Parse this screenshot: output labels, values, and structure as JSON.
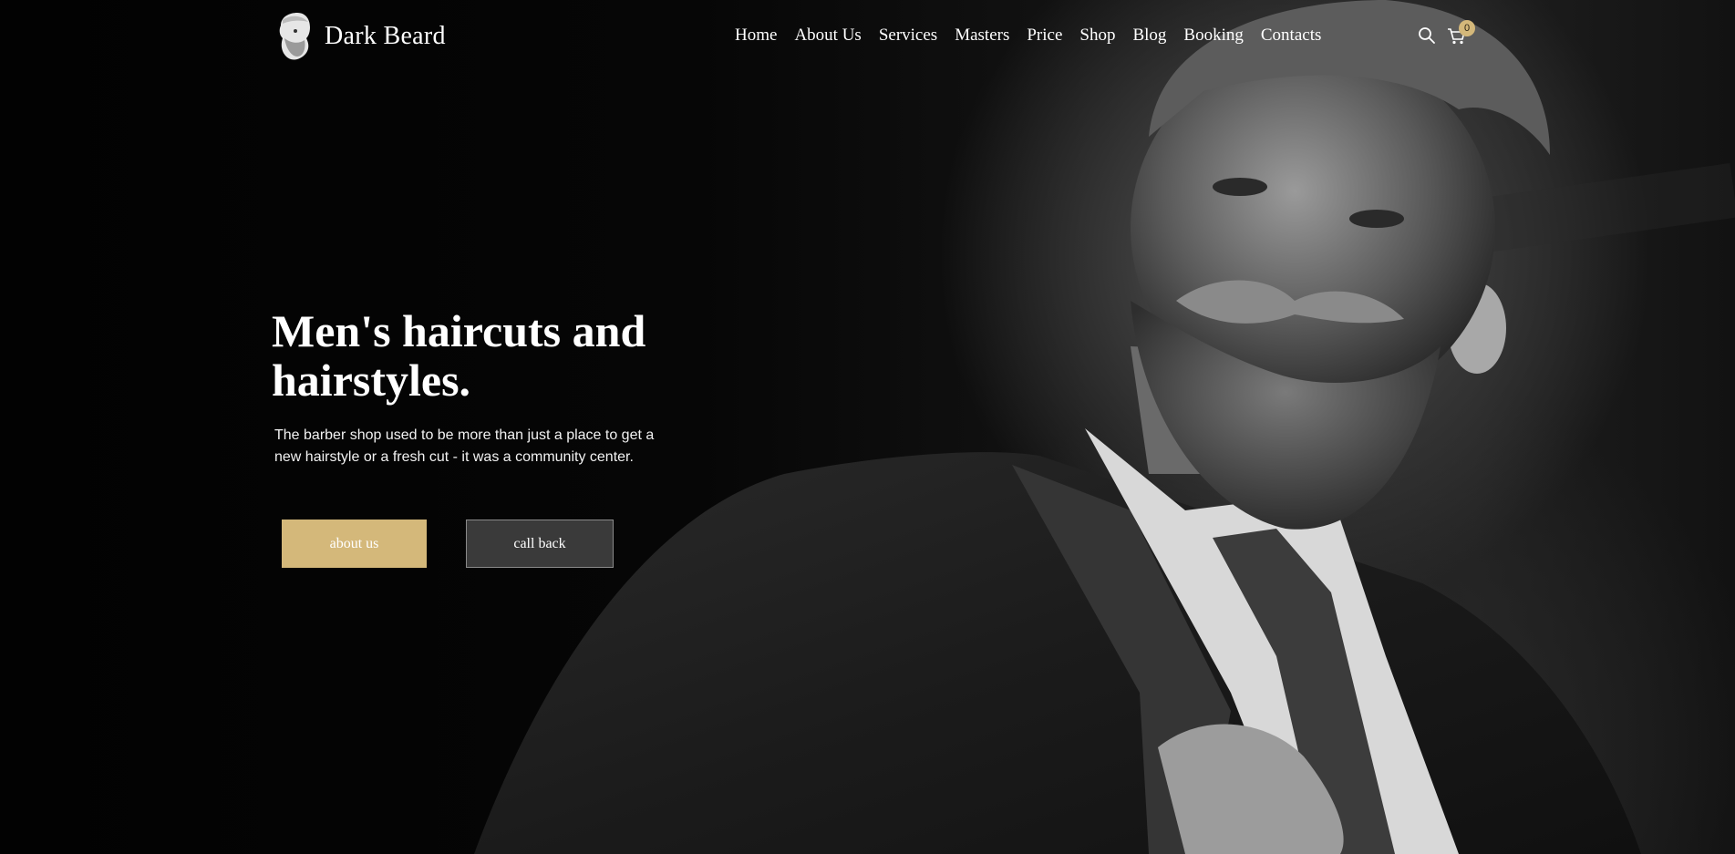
{
  "brand": {
    "name": "Dark Beard",
    "logo_icon": "bearded-man-head-icon"
  },
  "nav": {
    "items": [
      "Home",
      "About Us",
      "Services",
      "Masters",
      "Price",
      "Shop",
      "Blog",
      "Booking",
      "Contacts"
    ]
  },
  "header_icons": {
    "search": "search-icon",
    "cart": "cart-icon",
    "cart_count": "0"
  },
  "hero": {
    "title_line1": "Men's haircuts and",
    "title_line2": "hairstyles.",
    "description": "The barber shop used to be more than just a place to get a new hairstyle or a fresh cut - it was a community center.",
    "primary_button": "about us",
    "secondary_button": "call back"
  },
  "colors": {
    "accent": "#d4b87a",
    "secondary_button": "#3a3a3a",
    "background": "#050505"
  }
}
